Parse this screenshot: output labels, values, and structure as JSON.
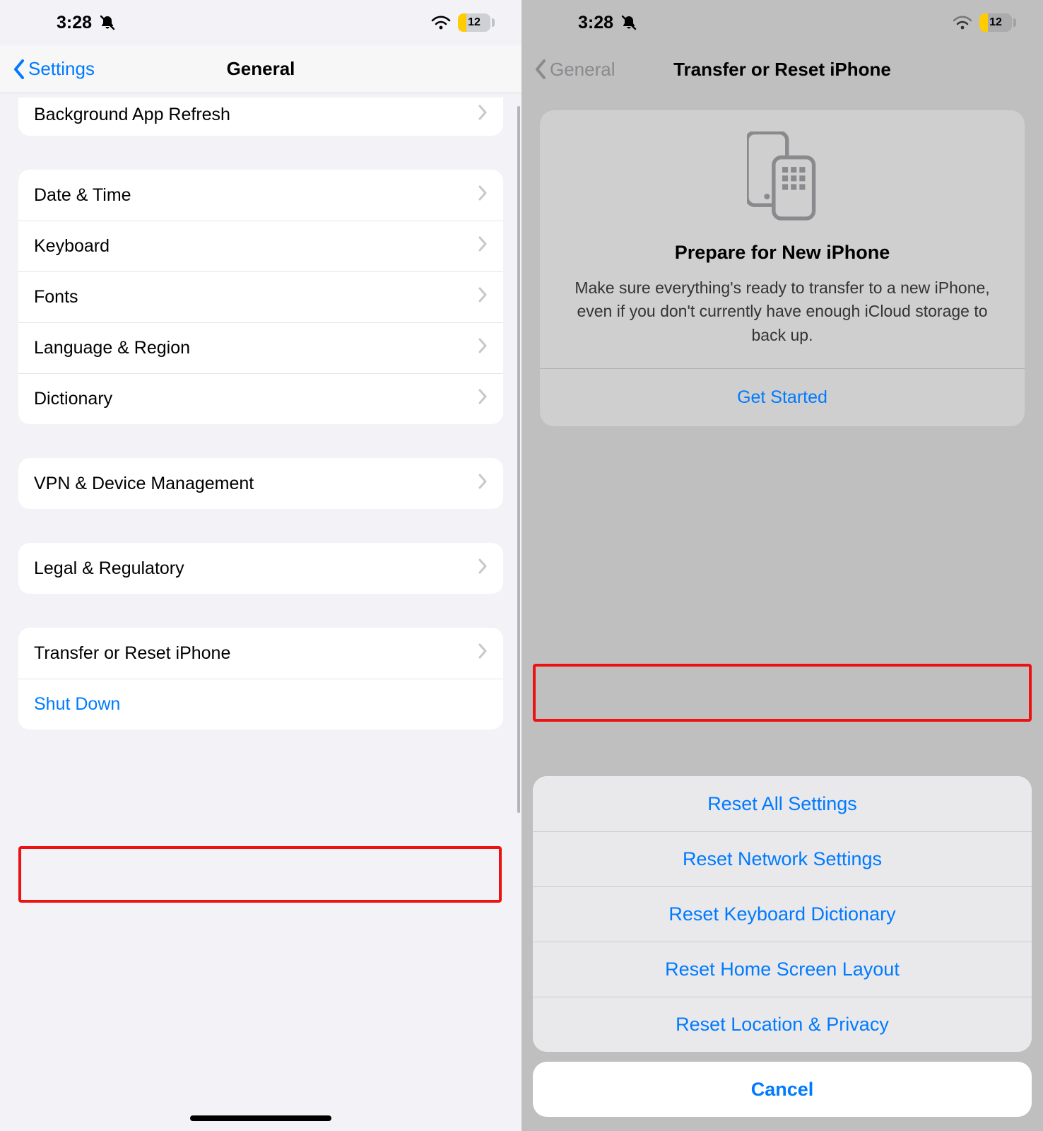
{
  "statusBar": {
    "time": "3:28",
    "batteryLevel": "12"
  },
  "left": {
    "back": "Settings",
    "title": "General",
    "rows": {
      "bgRefresh": "Background App Refresh",
      "dateTime": "Date & Time",
      "keyboard": "Keyboard",
      "fonts": "Fonts",
      "langRegion": "Language & Region",
      "dictionary": "Dictionary",
      "vpn": "VPN & Device Management",
      "legal": "Legal & Regulatory",
      "transferReset": "Transfer or Reset iPhone",
      "shutDown": "Shut Down"
    }
  },
  "right": {
    "back": "General",
    "title": "Transfer or Reset iPhone",
    "card": {
      "heading": "Prepare for New iPhone",
      "body": "Make sure everything's ready to transfer to a new iPhone, even if you don't currently have enough iCloud storage to back up.",
      "cta": "Get Started"
    },
    "sheet": {
      "resetAll": "Reset All Settings",
      "resetNetwork": "Reset Network Settings",
      "resetKeyboard": "Reset Keyboard Dictionary",
      "resetHome": "Reset Home Screen Layout",
      "resetLocation": "Reset Location & Privacy",
      "cancel": "Cancel"
    }
  }
}
